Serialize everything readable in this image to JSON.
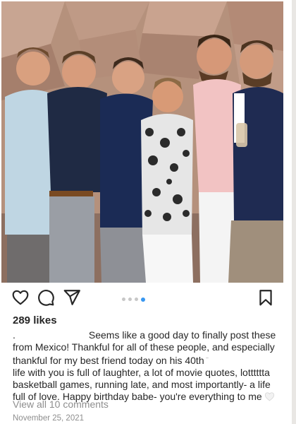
{
  "post": {
    "likes_text": "289 likes",
    "caption": {
      "line1_prefix": ".",
      "line1": "Seems like a good day to finally post these",
      "line2": "from Mexico! Thankful for all of these people, and especially",
      "line3": "thankful for my best friend today on his 40th",
      "line4": "life with you is full of laughter, a lot of movie quotes, lotttttta",
      "line5": "basketball games, running late, and most importantly- a life",
      "line6": "full of love. Happy birthday babe- you're everything to me"
    },
    "view_comments": "View all 10 comments",
    "date": "November 25, 2021",
    "carousel": {
      "count": 4,
      "active_index": 3
    }
  },
  "icons": {
    "like": "heart-outline-icon",
    "comment": "speech-bubble-icon",
    "share": "paper-plane-icon",
    "save": "bookmark-outline-icon",
    "caption_emoji": "white-heart-icon"
  },
  "colors": {
    "text": "#262626",
    "muted": "#8e8e8e",
    "carousel_active": "#3897f0",
    "carousel_inactive": "#c7c7c7"
  }
}
